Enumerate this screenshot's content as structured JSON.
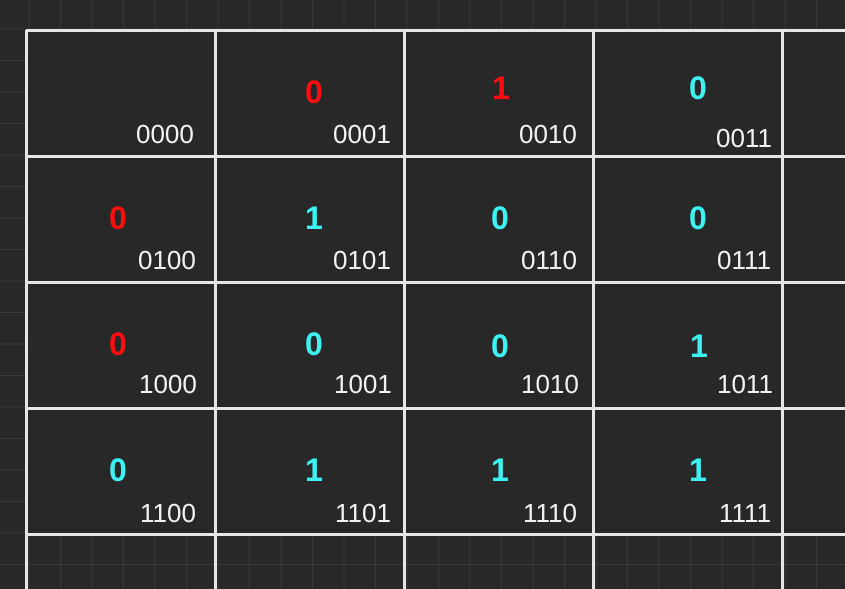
{
  "colors": {
    "background": "#282828",
    "grid_line": "#e6e6e6",
    "value_red": "#ff0d0d",
    "value_cyan": "#3df2f2",
    "code_text": "#f2f2f2"
  },
  "cells": [
    {
      "code": "0000",
      "value": "",
      "color": "none"
    },
    {
      "code": "0001",
      "value": "0",
      "color": "red"
    },
    {
      "code": "0010",
      "value": "1",
      "color": "red"
    },
    {
      "code": "0011",
      "value": "0",
      "color": "cyan"
    },
    {
      "code": "0100",
      "value": "0",
      "color": "red"
    },
    {
      "code": "0101",
      "value": "1",
      "color": "cyan"
    },
    {
      "code": "0110",
      "value": "0",
      "color": "cyan"
    },
    {
      "code": "0111",
      "value": "0",
      "color": "cyan"
    },
    {
      "code": "1000",
      "value": "0",
      "color": "red"
    },
    {
      "code": "1001",
      "value": "0",
      "color": "cyan"
    },
    {
      "code": "1010",
      "value": "0",
      "color": "cyan"
    },
    {
      "code": "1011",
      "value": "1",
      "color": "cyan"
    },
    {
      "code": "1100",
      "value": "0",
      "color": "cyan"
    },
    {
      "code": "1101",
      "value": "1",
      "color": "cyan"
    },
    {
      "code": "1110",
      "value": "1",
      "color": "cyan"
    },
    {
      "code": "1111",
      "value": "1",
      "color": "cyan"
    }
  ]
}
